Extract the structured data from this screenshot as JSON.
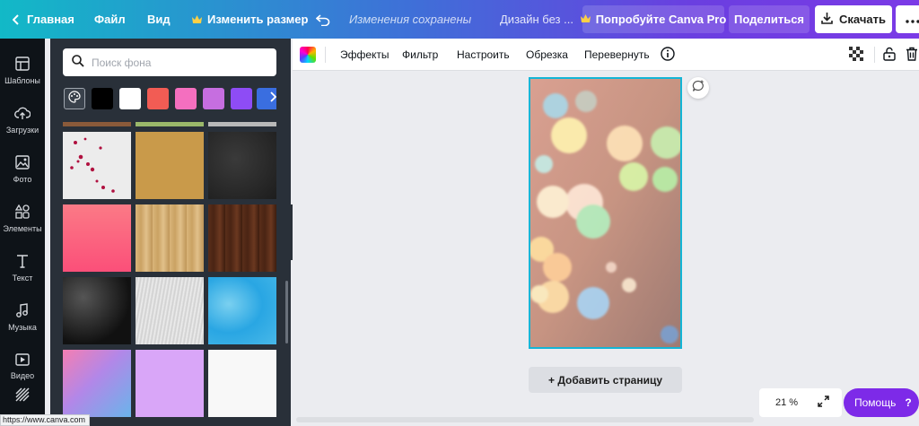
{
  "topbar": {
    "home": "Главная",
    "file": "Файл",
    "view": "Вид",
    "resize": "Изменить размер",
    "saved": "Изменения сохранены",
    "design_title": "Дизайн без ...",
    "try_pro": "Попробуйте Canva Pro",
    "share": "Поделиться",
    "download": "Скачать"
  },
  "rail": {
    "items": [
      {
        "label": "Шаблоны",
        "icon": "templates-icon"
      },
      {
        "label": "Загрузки",
        "icon": "upload-icon"
      },
      {
        "label": "Фото",
        "icon": "photo-icon"
      },
      {
        "label": "Элементы",
        "icon": "elements-icon"
      },
      {
        "label": "Текст",
        "icon": "text-icon"
      },
      {
        "label": "Музыка",
        "icon": "music-icon"
      },
      {
        "label": "Видео",
        "icon": "video-icon"
      }
    ]
  },
  "panel": {
    "search_placeholder": "Поиск фона",
    "swatches": [
      "#000000",
      "#ffffff",
      "#f25c54",
      "#f46fbf",
      "#c66ee0",
      "#8e4cf5",
      "#3a6ee0"
    ]
  },
  "toolbar": {
    "effects": "Эффекты",
    "filter": "Фильтр",
    "adjust": "Настроить",
    "crop": "Обрезка",
    "flip": "Перевернуть"
  },
  "canvas": {
    "add_page": "+ Добавить страницу"
  },
  "footer": {
    "zoom": "21 %",
    "help": "Помощь",
    "help_icon": "?",
    "status_url": "https://www.canva.com"
  }
}
